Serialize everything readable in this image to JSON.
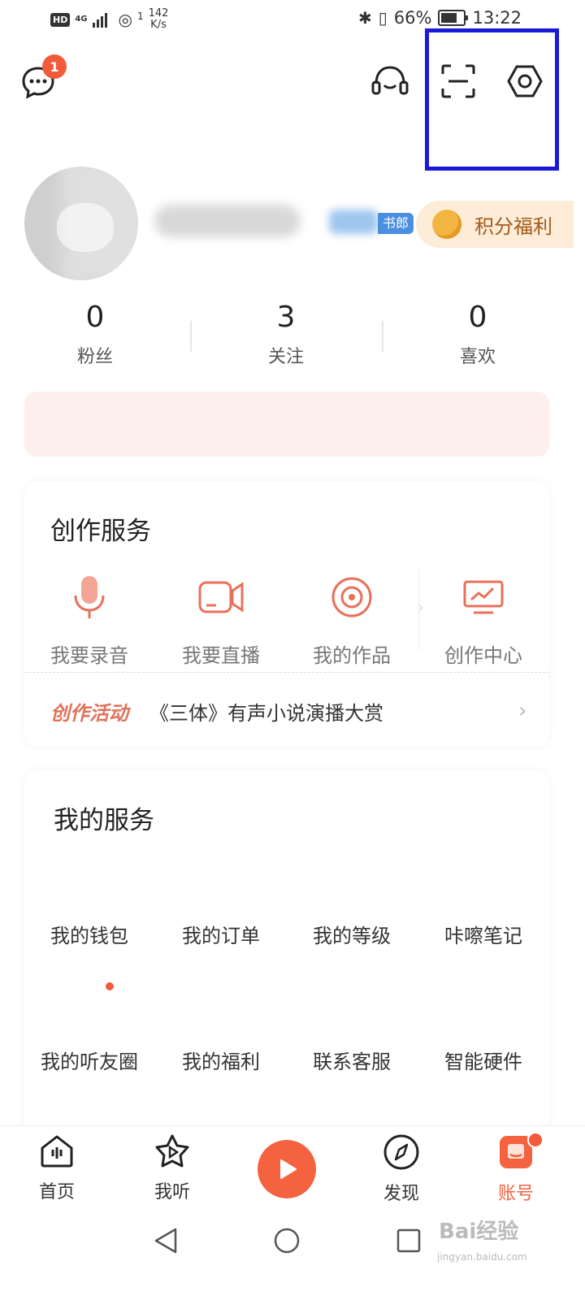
{
  "status_bar": {
    "hd": "HD",
    "network": "4G",
    "wifi_sub": "1",
    "speed_value": "142",
    "speed_unit": "K/s",
    "battery": "66%",
    "time": "13:22"
  },
  "header": {
    "message_badge": "1"
  },
  "profile": {
    "tag_suffix": "书郎",
    "points_label": "积分福利"
  },
  "stats": [
    {
      "value": "0",
      "label": "粉丝"
    },
    {
      "value": "3",
      "label": "关注"
    },
    {
      "value": "0",
      "label": "喜欢"
    }
  ],
  "creation": {
    "title": "创作服务",
    "items": [
      {
        "label": "我要录音",
        "icon": "microphone-icon"
      },
      {
        "label": "我要直播",
        "icon": "video-camera-icon"
      },
      {
        "label": "我的作品",
        "icon": "disc-icon"
      },
      {
        "label": "创作中心",
        "icon": "monitor-chart-icon"
      }
    ],
    "activity_tag": "创作活动",
    "activity_title": "《三体》有声小说演播大赏"
  },
  "my_services": {
    "title": "我的服务",
    "row1": [
      "我的钱包",
      "我的订单",
      "我的等级",
      "咔嚓笔记"
    ],
    "row2": [
      "我的听友圈",
      "我的福利",
      "联系客服",
      "智能硬件"
    ]
  },
  "bottom_nav": [
    {
      "label": "首页",
      "icon": "home-icon"
    },
    {
      "label": "我听",
      "icon": "star-play-icon"
    },
    {
      "label": "",
      "icon": "play-icon"
    },
    {
      "label": "发现",
      "icon": "compass-icon"
    },
    {
      "label": "账号",
      "icon": "account-icon"
    }
  ],
  "watermark": {
    "text": "Bai经验",
    "sub": "jingyan.baidu.com"
  },
  "colors": {
    "accent": "#f4623f",
    "highlight": "#1a1ad6"
  }
}
